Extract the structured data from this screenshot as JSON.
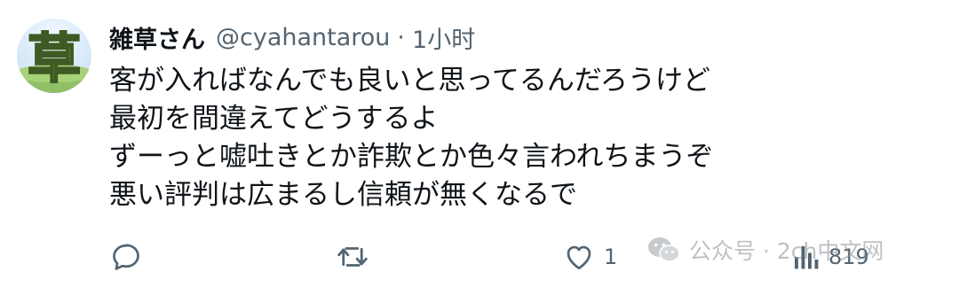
{
  "tweet": {
    "avatar_glyph": "草",
    "display_name": "雑草さん",
    "handle": "@cyahantarou",
    "separator": "·",
    "timestamp": "1小时",
    "lines": [
      "客が入ればなんでも良いと思ってるんだろうけど",
      "最初を間違えてどうするよ",
      "ずーっと嘘吐きとか詐欺とか色々言われちまうぞ",
      "悪い評判は広まるし信頼が無くなるで"
    ]
  },
  "actions": {
    "reply_icon": "reply-bubble-icon",
    "retweet_icon": "retweet-icon",
    "like_icon": "heart-icon",
    "like_count": "1",
    "views_icon": "bar-chart-icon",
    "views_count": "819"
  },
  "watermark": {
    "icon": "wechat-icon",
    "text": "公众号 · 2ch中文网"
  },
  "colors": {
    "text_primary": "#0f1419",
    "text_secondary": "#536471",
    "background": "#ffffff"
  }
}
